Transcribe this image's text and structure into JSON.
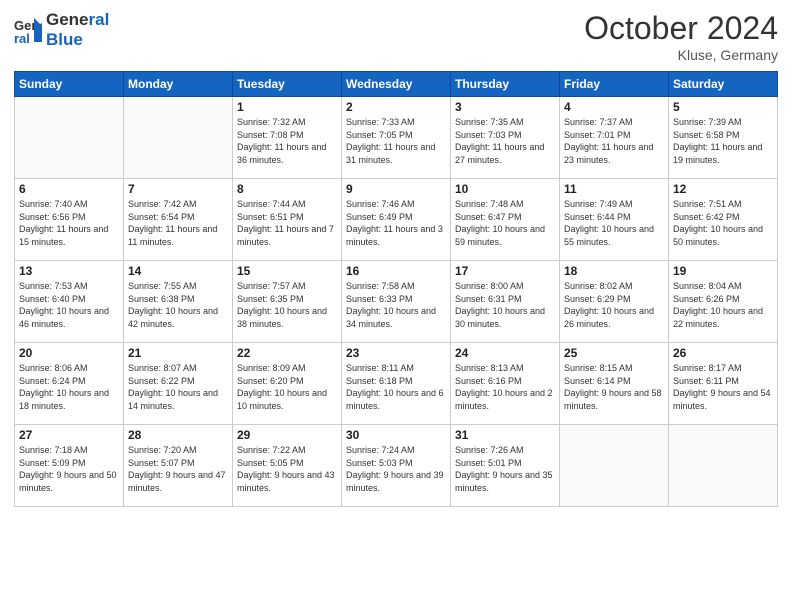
{
  "header": {
    "logo_line1": "General",
    "logo_line2": "Blue",
    "month_title": "October 2024",
    "location": "Kluse, Germany"
  },
  "weekdays": [
    "Sunday",
    "Monday",
    "Tuesday",
    "Wednesday",
    "Thursday",
    "Friday",
    "Saturday"
  ],
  "weeks": [
    [
      {
        "day": "",
        "sunrise": "",
        "sunset": "",
        "daylight": ""
      },
      {
        "day": "",
        "sunrise": "",
        "sunset": "",
        "daylight": ""
      },
      {
        "day": "1",
        "sunrise": "Sunrise: 7:32 AM",
        "sunset": "Sunset: 7:08 PM",
        "daylight": "Daylight: 11 hours and 36 minutes."
      },
      {
        "day": "2",
        "sunrise": "Sunrise: 7:33 AM",
        "sunset": "Sunset: 7:05 PM",
        "daylight": "Daylight: 11 hours and 31 minutes."
      },
      {
        "day": "3",
        "sunrise": "Sunrise: 7:35 AM",
        "sunset": "Sunset: 7:03 PM",
        "daylight": "Daylight: 11 hours and 27 minutes."
      },
      {
        "day": "4",
        "sunrise": "Sunrise: 7:37 AM",
        "sunset": "Sunset: 7:01 PM",
        "daylight": "Daylight: 11 hours and 23 minutes."
      },
      {
        "day": "5",
        "sunrise": "Sunrise: 7:39 AM",
        "sunset": "Sunset: 6:58 PM",
        "daylight": "Daylight: 11 hours and 19 minutes."
      }
    ],
    [
      {
        "day": "6",
        "sunrise": "Sunrise: 7:40 AM",
        "sunset": "Sunset: 6:56 PM",
        "daylight": "Daylight: 11 hours and 15 minutes."
      },
      {
        "day": "7",
        "sunrise": "Sunrise: 7:42 AM",
        "sunset": "Sunset: 6:54 PM",
        "daylight": "Daylight: 11 hours and 11 minutes."
      },
      {
        "day": "8",
        "sunrise": "Sunrise: 7:44 AM",
        "sunset": "Sunset: 6:51 PM",
        "daylight": "Daylight: 11 hours and 7 minutes."
      },
      {
        "day": "9",
        "sunrise": "Sunrise: 7:46 AM",
        "sunset": "Sunset: 6:49 PM",
        "daylight": "Daylight: 11 hours and 3 minutes."
      },
      {
        "day": "10",
        "sunrise": "Sunrise: 7:48 AM",
        "sunset": "Sunset: 6:47 PM",
        "daylight": "Daylight: 10 hours and 59 minutes."
      },
      {
        "day": "11",
        "sunrise": "Sunrise: 7:49 AM",
        "sunset": "Sunset: 6:44 PM",
        "daylight": "Daylight: 10 hours and 55 minutes."
      },
      {
        "day": "12",
        "sunrise": "Sunrise: 7:51 AM",
        "sunset": "Sunset: 6:42 PM",
        "daylight": "Daylight: 10 hours and 50 minutes."
      }
    ],
    [
      {
        "day": "13",
        "sunrise": "Sunrise: 7:53 AM",
        "sunset": "Sunset: 6:40 PM",
        "daylight": "Daylight: 10 hours and 46 minutes."
      },
      {
        "day": "14",
        "sunrise": "Sunrise: 7:55 AM",
        "sunset": "Sunset: 6:38 PM",
        "daylight": "Daylight: 10 hours and 42 minutes."
      },
      {
        "day": "15",
        "sunrise": "Sunrise: 7:57 AM",
        "sunset": "Sunset: 6:35 PM",
        "daylight": "Daylight: 10 hours and 38 minutes."
      },
      {
        "day": "16",
        "sunrise": "Sunrise: 7:58 AM",
        "sunset": "Sunset: 6:33 PM",
        "daylight": "Daylight: 10 hours and 34 minutes."
      },
      {
        "day": "17",
        "sunrise": "Sunrise: 8:00 AM",
        "sunset": "Sunset: 6:31 PM",
        "daylight": "Daylight: 10 hours and 30 minutes."
      },
      {
        "day": "18",
        "sunrise": "Sunrise: 8:02 AM",
        "sunset": "Sunset: 6:29 PM",
        "daylight": "Daylight: 10 hours and 26 minutes."
      },
      {
        "day": "19",
        "sunrise": "Sunrise: 8:04 AM",
        "sunset": "Sunset: 6:26 PM",
        "daylight": "Daylight: 10 hours and 22 minutes."
      }
    ],
    [
      {
        "day": "20",
        "sunrise": "Sunrise: 8:06 AM",
        "sunset": "Sunset: 6:24 PM",
        "daylight": "Daylight: 10 hours and 18 minutes."
      },
      {
        "day": "21",
        "sunrise": "Sunrise: 8:07 AM",
        "sunset": "Sunset: 6:22 PM",
        "daylight": "Daylight: 10 hours and 14 minutes."
      },
      {
        "day": "22",
        "sunrise": "Sunrise: 8:09 AM",
        "sunset": "Sunset: 6:20 PM",
        "daylight": "Daylight: 10 hours and 10 minutes."
      },
      {
        "day": "23",
        "sunrise": "Sunrise: 8:11 AM",
        "sunset": "Sunset: 6:18 PM",
        "daylight": "Daylight: 10 hours and 6 minutes."
      },
      {
        "day": "24",
        "sunrise": "Sunrise: 8:13 AM",
        "sunset": "Sunset: 6:16 PM",
        "daylight": "Daylight: 10 hours and 2 minutes."
      },
      {
        "day": "25",
        "sunrise": "Sunrise: 8:15 AM",
        "sunset": "Sunset: 6:14 PM",
        "daylight": "Daylight: 9 hours and 58 minutes."
      },
      {
        "day": "26",
        "sunrise": "Sunrise: 8:17 AM",
        "sunset": "Sunset: 6:11 PM",
        "daylight": "Daylight: 9 hours and 54 minutes."
      }
    ],
    [
      {
        "day": "27",
        "sunrise": "Sunrise: 7:18 AM",
        "sunset": "Sunset: 5:09 PM",
        "daylight": "Daylight: 9 hours and 50 minutes."
      },
      {
        "day": "28",
        "sunrise": "Sunrise: 7:20 AM",
        "sunset": "Sunset: 5:07 PM",
        "daylight": "Daylight: 9 hours and 47 minutes."
      },
      {
        "day": "29",
        "sunrise": "Sunrise: 7:22 AM",
        "sunset": "Sunset: 5:05 PM",
        "daylight": "Daylight: 9 hours and 43 minutes."
      },
      {
        "day": "30",
        "sunrise": "Sunrise: 7:24 AM",
        "sunset": "Sunset: 5:03 PM",
        "daylight": "Daylight: 9 hours and 39 minutes."
      },
      {
        "day": "31",
        "sunrise": "Sunrise: 7:26 AM",
        "sunset": "Sunset: 5:01 PM",
        "daylight": "Daylight: 9 hours and 35 minutes."
      },
      {
        "day": "",
        "sunrise": "",
        "sunset": "",
        "daylight": ""
      },
      {
        "day": "",
        "sunrise": "",
        "sunset": "",
        "daylight": ""
      }
    ]
  ]
}
